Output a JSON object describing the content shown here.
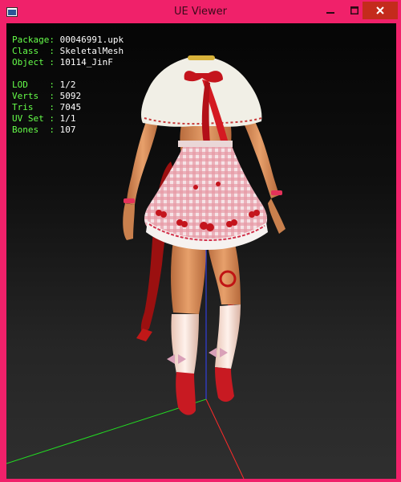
{
  "window": {
    "title": "UE Viewer",
    "controls": {
      "minimize": "minimize",
      "maximize": "maximize",
      "close": "close"
    }
  },
  "info": {
    "package": {
      "label": "Package:",
      "value": "00046991.upk"
    },
    "class": {
      "label": "Class  :",
      "value": "SkeletalMesh"
    },
    "object": {
      "label": "Object :",
      "value": "10114_JinF"
    },
    "lod": {
      "label": "LOD    :",
      "value": "1/2"
    },
    "verts": {
      "label": "Verts  :",
      "value": "5092"
    },
    "tris": {
      "label": "Tris   :",
      "value": "7045"
    },
    "uvset": {
      "label": "UV Set :",
      "value": "1/1"
    },
    "bones": {
      "label": "Bones  :",
      "value": "107"
    }
  },
  "colors": {
    "window_frame": "#f0216a",
    "close_button": "#c42b1c",
    "info_label": "#66ff4a",
    "info_value": "#ffffff",
    "axis_x": "#ff2a2a",
    "axis_y": "#22dd22",
    "axis_z": "#3344ff"
  },
  "icons": [
    "app-icon",
    "minimize-icon",
    "maximize-icon",
    "close-icon"
  ]
}
